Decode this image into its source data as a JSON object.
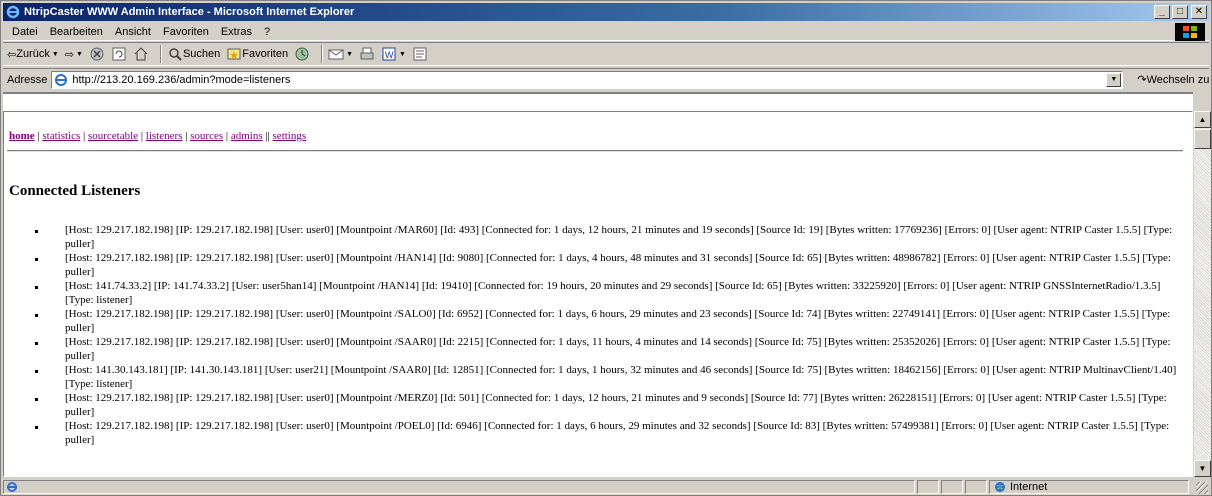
{
  "window": {
    "title": "NtripCaster WWW Admin Interface - Microsoft Internet Explorer",
    "minimize_label": "_",
    "maximize_label": "□",
    "close_label": "✕"
  },
  "menu": [
    "Datei",
    "Bearbeiten",
    "Ansicht",
    "Favoriten",
    "Extras",
    "?"
  ],
  "toolbar": {
    "back_label": "Zurück",
    "search_label": "Suchen",
    "favorites_label": "Favoriten"
  },
  "address": {
    "label": "Adresse",
    "url": "http://213.20.169.236/admin?mode=listeners",
    "go_label": "Wechseln zu"
  },
  "nav": {
    "home": "home",
    "statistics": "statistics",
    "sourcetable": "sourcetable",
    "listeners": "listeners",
    "sources": "sources",
    "admins": "admins",
    "settings": "settings"
  },
  "page": {
    "heading": "Connected Listeners"
  },
  "listeners": [
    "[Host: 129.217.182.198] [IP: 129.217.182.198] [User: user0] [Mountpoint /MAR60] [Id: 493] [Connected for: 1 days, 12 hours, 21 minutes and 19 seconds] [Source Id: 19] [Bytes written: 17769236] [Errors: 0] [User agent: NTRIP Caster 1.5.5] [Type: puller]",
    "[Host: 129.217.182.198] [IP: 129.217.182.198] [User: user0] [Mountpoint /HAN14] [Id: 9080] [Connected for: 1 days, 4 hours, 48 minutes and 31 seconds] [Source Id: 65] [Bytes written: 48986782] [Errors: 0] [User agent: NTRIP Caster 1.5.5] [Type: puller]",
    "[Host: 141.74.33.2] [IP: 141.74.33.2] [User: user5han14] [Mountpoint /HAN14] [Id: 19410] [Connected for: 19 hours, 20 minutes and 29 seconds] [Source Id: 65] [Bytes written: 33225920] [Errors: 0] [User agent: NTRIP GNSSInternetRadio/1.3.5] [Type: listener]",
    "[Host: 129.217.182.198] [IP: 129.217.182.198] [User: user0] [Mountpoint /SALO0] [Id: 6952] [Connected for: 1 days, 6 hours, 29 minutes and 23 seconds] [Source Id: 74] [Bytes written: 22749141] [Errors: 0] [User agent: NTRIP Caster 1.5.5] [Type: puller]",
    "[Host: 129.217.182.198] [IP: 129.217.182.198] [User: user0] [Mountpoint /SAAR0] [Id: 2215] [Connected for: 1 days, 11 hours, 4 minutes and 14 seconds] [Source Id: 75] [Bytes written: 25352026] [Errors: 0] [User agent: NTRIP Caster 1.5.5] [Type: puller]",
    "[Host: 141.30.143.181] [IP: 141.30.143.181] [User: user21] [Mountpoint /SAAR0] [Id: 12851] [Connected for: 1 days, 1 hours, 32 minutes and 46 seconds] [Source Id: 75] [Bytes written: 18462156] [Errors: 0] [User agent: NTRIP MultinavClient/1.40] [Type: listener]",
    "[Host: 129.217.182.198] [IP: 129.217.182.198] [User: user0] [Mountpoint /MERZ0] [Id: 501] [Connected for: 1 days, 12 hours, 21 minutes and 9 seconds] [Source Id: 77] [Bytes written: 26228151] [Errors: 0] [User agent: NTRIP Caster 1.5.5] [Type: puller]",
    "[Host: 129.217.182.198] [IP: 129.217.182.198] [User: user0] [Mountpoint /POEL0] [Id: 6946] [Connected for: 1 days, 6 hours, 29 minutes and 32 seconds] [Source Id: 83] [Bytes written: 57499381] [Errors: 0] [User agent: NTRIP Caster 1.5.5] [Type: puller]"
  ],
  "status": {
    "zone": "Internet"
  }
}
